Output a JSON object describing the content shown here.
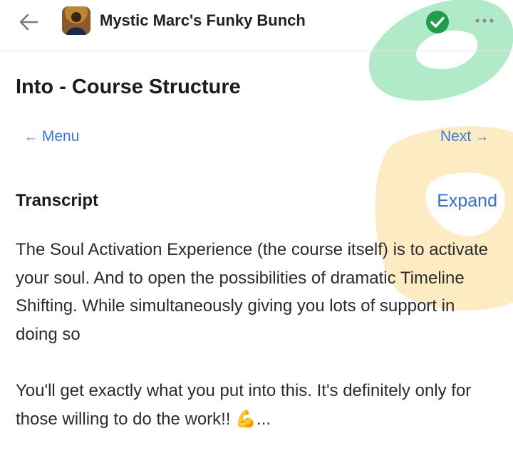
{
  "header": {
    "group_title": "Mystic Marc's Funky Bunch",
    "back_icon": "back-arrow-icon",
    "verified_icon": "check-circle-icon",
    "more_icon": "more-horizontal-icon"
  },
  "lesson": {
    "title": "Into - Course Structure",
    "nav": {
      "menu_label": "Menu",
      "menu_arrow": "←",
      "next_label": "Next",
      "next_arrow": "→"
    }
  },
  "transcript": {
    "heading": "Transcript",
    "expand_label": "Expand",
    "paragraphs": [
      "The Soul Activation Experience (the course itself) is to activate your soul. And to open the possibilities of dramatic Timeline Shifting. While simultaneously giving you lots of support in doing so",
      "You'll get exactly what you put into this. It's definitely only for those willing to do the work!! 💪..."
    ]
  },
  "colors": {
    "accent": "#3a78d6",
    "verified": "#1f9d4c",
    "overlay_green": "#a9e8c2",
    "overlay_yellow": "#fde7b8"
  }
}
